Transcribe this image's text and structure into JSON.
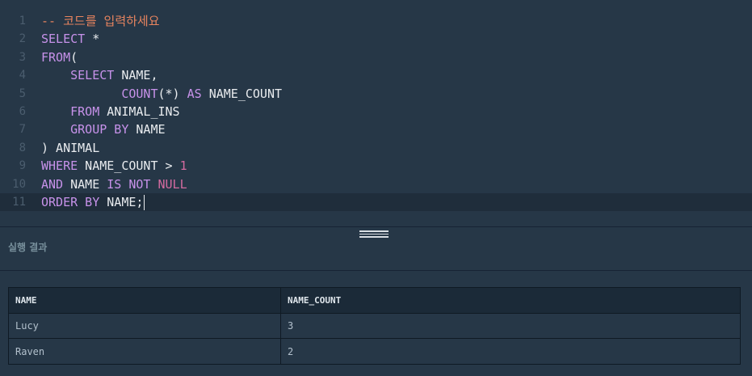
{
  "editor": {
    "lines": [
      {
        "number": "1",
        "tokens": [
          {
            "text": "-- 코드를 입력하세요",
            "type": "comment"
          }
        ]
      },
      {
        "number": "2",
        "tokens": [
          {
            "text": "SELECT",
            "type": "keyword"
          },
          {
            "text": " *",
            "type": "plain"
          }
        ]
      },
      {
        "number": "3",
        "tokens": [
          {
            "text": "FROM",
            "type": "keyword"
          },
          {
            "text": "(",
            "type": "plain"
          }
        ]
      },
      {
        "number": "4",
        "tokens": [
          {
            "text": "    ",
            "type": "plain"
          },
          {
            "text": "SELECT",
            "type": "keyword"
          },
          {
            "text": " NAME,",
            "type": "plain"
          }
        ]
      },
      {
        "number": "5",
        "tokens": [
          {
            "text": "           ",
            "type": "plain"
          },
          {
            "text": "COUNT",
            "type": "keyword"
          },
          {
            "text": "(*) ",
            "type": "plain"
          },
          {
            "text": "AS",
            "type": "keyword"
          },
          {
            "text": " NAME_COUNT",
            "type": "plain"
          }
        ]
      },
      {
        "number": "6",
        "tokens": [
          {
            "text": "    ",
            "type": "plain"
          },
          {
            "text": "FROM",
            "type": "keyword"
          },
          {
            "text": " ANIMAL_INS",
            "type": "plain"
          }
        ]
      },
      {
        "number": "7",
        "tokens": [
          {
            "text": "    ",
            "type": "plain"
          },
          {
            "text": "GROUP BY",
            "type": "keyword"
          },
          {
            "text": " NAME",
            "type": "plain"
          }
        ]
      },
      {
        "number": "8",
        "tokens": [
          {
            "text": ") ANIMAL",
            "type": "plain"
          }
        ]
      },
      {
        "number": "9",
        "tokens": [
          {
            "text": "WHERE",
            "type": "keyword"
          },
          {
            "text": " NAME_COUNT > ",
            "type": "plain"
          },
          {
            "text": "1",
            "type": "number"
          }
        ]
      },
      {
        "number": "10",
        "tokens": [
          {
            "text": "AND",
            "type": "keyword"
          },
          {
            "text": " NAME ",
            "type": "plain"
          },
          {
            "text": "IS NOT",
            "type": "keyword"
          },
          {
            "text": " ",
            "type": "plain"
          },
          {
            "text": "NULL",
            "type": "number"
          }
        ]
      },
      {
        "number": "11",
        "tokens": [
          {
            "text": "ORDER BY",
            "type": "keyword"
          },
          {
            "text": " NAME;",
            "type": "plain"
          }
        ],
        "active": true
      }
    ]
  },
  "results": {
    "title": "실행 결과",
    "columns": [
      "NAME",
      "NAME_COUNT"
    ],
    "rows": [
      [
        "Lucy",
        "3"
      ],
      [
        "Raven",
        "2"
      ]
    ]
  },
  "colors": {
    "background": "#263747",
    "keyword": "#c792ea",
    "comment": "#e8845f",
    "number": "#d46ba0",
    "text": "#e9ecef"
  }
}
